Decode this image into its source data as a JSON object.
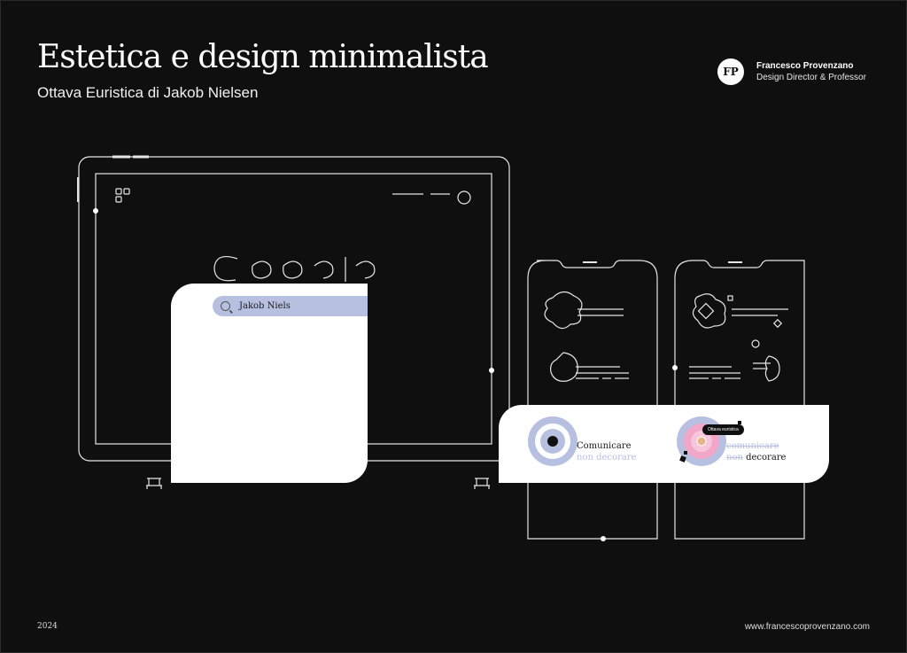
{
  "header": {
    "title": "Estetica e design minimalista",
    "subtitle": "Ottava Euristica di Jakob Nielsen"
  },
  "brand": {
    "logo_letters": "FP",
    "name": "Francesco Provenzano",
    "role": "Design Director & Professor"
  },
  "search": {
    "query": "Jakob Niels",
    "icon": "search-icon"
  },
  "comparison": {
    "left_line1": "Comunicare",
    "left_line2": "non decorare",
    "right_line1": "comunicare",
    "right_line2_strike": "non",
    "right_line2": "decorare",
    "badge": "Ottava euristica"
  },
  "footer": {
    "year": "2024",
    "url": "www.francescoprovenzano.com"
  },
  "colors": {
    "background": "#0f0f0f",
    "accent": "#b8c0e2",
    "pink": "#f2a7c8",
    "outline": "#e6e6e6"
  }
}
